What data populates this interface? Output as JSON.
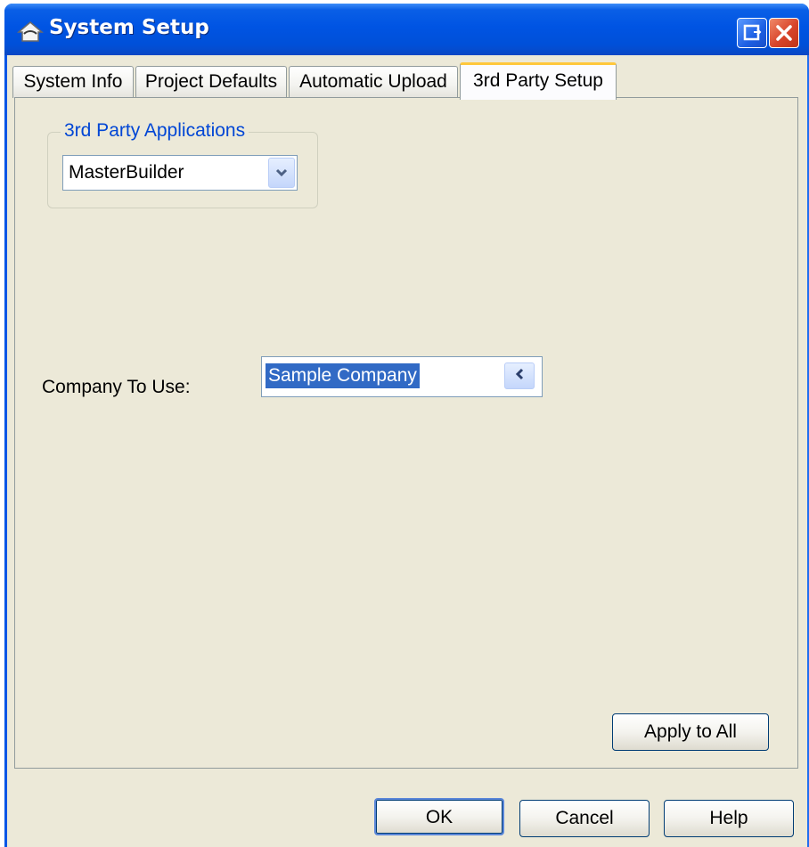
{
  "window": {
    "title": "System Setup",
    "icon": "house-icon",
    "controls": {
      "restore": "restore-icon",
      "close": "close-icon"
    }
  },
  "tabs": [
    {
      "label": "System Info",
      "active": false
    },
    {
      "label": "Project Defaults",
      "active": false
    },
    {
      "label": "Automatic Upload",
      "active": false
    },
    {
      "label": "3rd Party Setup",
      "active": true
    }
  ],
  "third_party": {
    "group_label": "3rd Party Applications",
    "selected_application": "MasterBuilder"
  },
  "company": {
    "label": "Company To Use:",
    "value": "Sample Company"
  },
  "buttons": {
    "apply_all": "Apply to All",
    "ok": "OK",
    "cancel": "Cancel",
    "help": "Help"
  },
  "colors": {
    "titlebar": "#0054e3",
    "dialog_bg": "#ece9d8",
    "group_label": "#0046d5",
    "selection": "#316ac5",
    "active_tab_accent": "#ffc83c"
  }
}
